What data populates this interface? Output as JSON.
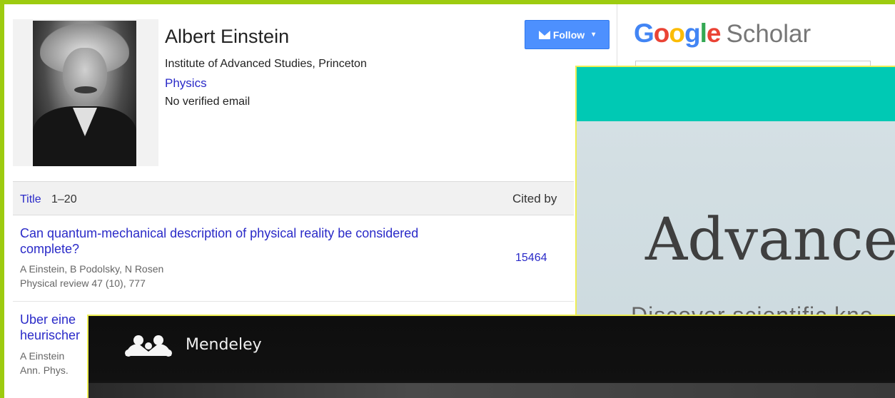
{
  "profile": {
    "name": "Albert Einstein",
    "affiliation": "Institute of Advanced Studies, Princeton",
    "interest": "Physics",
    "email_status": "No verified email",
    "follow_label": "Follow"
  },
  "google_scholar": {
    "logo_letters": [
      "G",
      "o",
      "o",
      "g",
      "l",
      "e"
    ],
    "logo_suffix": "Scholar"
  },
  "table": {
    "title_label": "Title",
    "range": "1–20",
    "cited_by_label": "Cited by"
  },
  "publications": [
    {
      "title": "Can quantum-mechanical description of physical reality be considered complete?",
      "authors": "A Einstein, B Podolsky, N Rosen",
      "venue": "Physical review 47 (10), 777",
      "cited_by": "15464"
    },
    {
      "title": "Uber eine",
      "title_line2": "heurischer",
      "authors": "A Einstein",
      "venue": "Ann. Phys."
    }
  ],
  "mendeley_site": {
    "hero_title": "Advance",
    "hero_subtitle": "Discover scientific kno",
    "colors": {
      "top_bar": "#00c9b4"
    }
  },
  "mendeley_app": {
    "brand_name": "Mendeley"
  },
  "colors": {
    "frame": "#9dcb0f",
    "link": "#2a2ac8",
    "follow_button": "#4d90fe"
  }
}
